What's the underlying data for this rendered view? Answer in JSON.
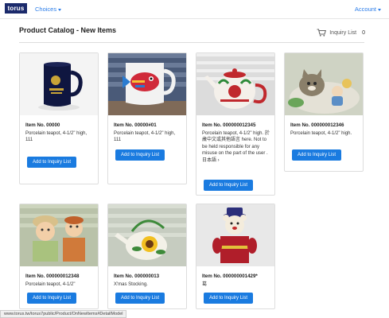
{
  "navbar": {
    "logo": "torus",
    "choices": "Choices",
    "account": "Account"
  },
  "header": {
    "title": "Product Catalog - New Items",
    "inquiry_label": "Inquiry List",
    "inquiry_count": "0"
  },
  "products": [
    {
      "item_no": "Item No. 00000",
      "description": "Porcelain teapot, 4-1/2\" high, 111",
      "button": "Add to Inquiry List"
    },
    {
      "item_no": "Item No. 00000#01",
      "description": "Porcelain teapot, 4-1/2\" high, 111",
      "button": "Add to Inquiry List"
    },
    {
      "item_no": "Item No. 000000012345",
      "description": "Porcelain teapot, 4-1/2\" high. 於歲中文或其他語言 here. Not to be held responsible for any misuse on the part of the user .日本語 ›",
      "button": "Add to Inquiry List"
    },
    {
      "item_no": "Item No. 000000012346",
      "description": "Porcelain teapot, 4-1/2\" high.",
      "button": "Add to Inquiry List"
    },
    {
      "item_no": "Item No. 000000012348",
      "description": "Porcelain teapot, 4-1/2\"",
      "button": "Add to Inquiry List"
    },
    {
      "item_no": "Item No. 000000013",
      "description": "X'mas Stocking.",
      "button": "Add to Inquiry List"
    },
    {
      "item_no": "Item No. 000000001429*",
      "description": "葛",
      "button": "Add to Inquiry List"
    }
  ],
  "status_bar": "www.torus.tw/torus7public/Product/OnNewItems#DetailModel",
  "colors": {
    "accent": "#1a7be0",
    "link": "#2b7de9",
    "logo_bg": "#1b2a6b"
  }
}
